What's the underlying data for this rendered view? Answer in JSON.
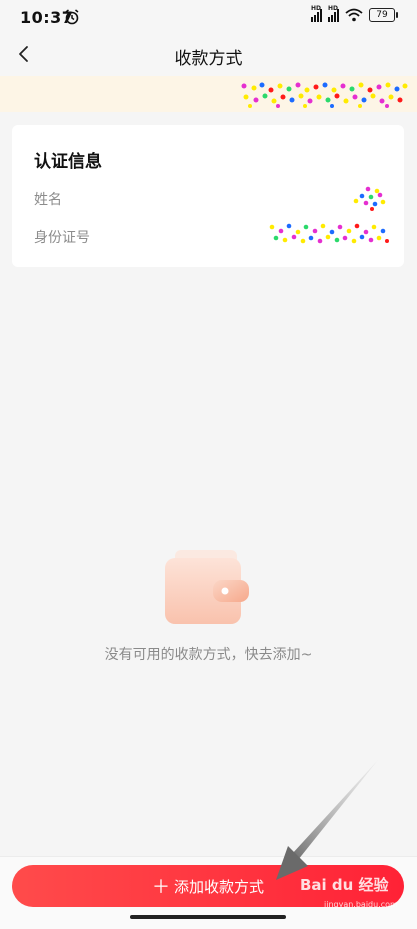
{
  "status_bar": {
    "time": "10:37",
    "network_1": "HD",
    "network_2": "HD",
    "battery": "79"
  },
  "header": {
    "title": "收款方式"
  },
  "auth_card": {
    "title": "认证信息",
    "name_label": "姓名",
    "id_label": "身份证号"
  },
  "empty_state": {
    "message": "没有可用的收款方式，快去添加~"
  },
  "bottom": {
    "add_label": "添加收款方式"
  },
  "watermark": {
    "brand": "Bai du 经验",
    "url": "jingyan.baidu.com"
  },
  "colors": {
    "accent": "#ff3040",
    "notice_bg": "#fdf5e6",
    "page_bg": "#f5f5f5"
  }
}
